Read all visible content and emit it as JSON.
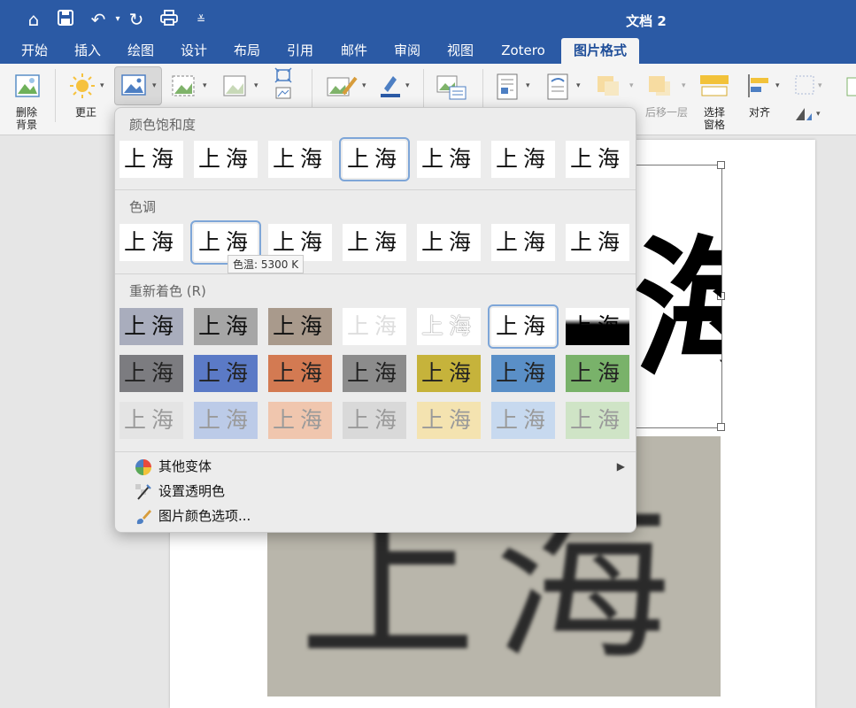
{
  "window": {
    "title": "文档 2"
  },
  "quick_access": {
    "icons": [
      "home-icon",
      "save-icon",
      "undo-icon",
      "redo-icon",
      "print-icon",
      "customize-icon"
    ]
  },
  "tabs": [
    "开始",
    "插入",
    "绘图",
    "设计",
    "布局",
    "引用",
    "邮件",
    "审阅",
    "视图",
    "Zotero",
    "图片格式"
  ],
  "active_tab": "图片格式",
  "ribbon": {
    "remove_bg": "删除\n背景",
    "corrections": "更正",
    "send_backward": "后移一层",
    "selection_pane": "选择\n窗格",
    "align": "对齐"
  },
  "panel": {
    "saturation_title": "颜色饱和度",
    "tone_title": "色调",
    "recolor_title": "重新着色 (R)",
    "thumb_text": "上海",
    "tooltip": "色温: 5300 K",
    "menu": {
      "more_variations": "其他变体",
      "set_transparent": "设置透明色",
      "color_options": "图片颜色选项..."
    }
  },
  "colors": {
    "title_bar": "#2b5aa5",
    "recolor_row2": [
      "#7c7c80",
      "#5b7ac6",
      "#d37a52",
      "#8c8c8c",
      "#c6b33b",
      "#5a8fc7",
      "#79b26a"
    ],
    "recolor_row3": [
      "#e4e4e4",
      "#bccbe8",
      "#f0c6ae",
      "#d9d9d9",
      "#f4e3b0",
      "#c7d9ef",
      "#cfe4c6"
    ]
  },
  "document": {
    "photo_text": "上海",
    "bw_char": "海"
  }
}
